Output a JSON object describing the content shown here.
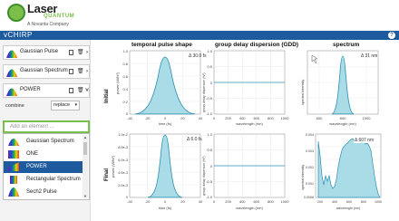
{
  "brand": {
    "name": "Laser",
    "sub": "QUANTUM",
    "tag": "A Novanta Company"
  },
  "app": {
    "title": "vCHIRP",
    "help": "?"
  },
  "pulses": [
    {
      "label": "Gaussian Pulse"
    },
    {
      "label": "Gaussian Spectrum"
    },
    {
      "label": "POWER"
    }
  ],
  "combine": {
    "label": "combine",
    "value": "replace"
  },
  "add_element": {
    "placeholder": "Add an element ..."
  },
  "dropdown": {
    "items": [
      "Gaussian Spectrum",
      "ONE",
      "POWER",
      "Rectangular Spectrum",
      "Sech2 Pulse"
    ],
    "selected": "POWER"
  },
  "plots": {
    "col_titles": [
      "temporal pulse shape",
      "group delay dispersion (GDD)",
      "spectrum"
    ],
    "rows": [
      "Initial",
      "Final"
    ],
    "initial": {
      "temporal": {
        "annotation": "Δ 30.0 fs",
        "ylabel": "power (W/fs²)",
        "xlabel": "time (fs)",
        "yticks": [
          "1.0",
          "0.8",
          "0.6",
          "0.4",
          "0.2",
          "0"
        ],
        "xticks": [
          "-40",
          "-20",
          "0",
          "20",
          "40"
        ]
      },
      "gdd": {
        "ylabel": "group delay dispersion (fs²)",
        "xlabel": "wavelength (nm)",
        "yticks": [
          "1.0",
          "0.5",
          "0",
          "-0.5",
          "-1.0"
        ],
        "xticks": [
          "0",
          "200",
          "400",
          "600",
          "800",
          "1000"
        ]
      },
      "spectrum": {
        "annotation": "Δ 31 nm",
        "ylabel": "spectral intensity",
        "xlabel": "wavelength (nm)",
        "xticks": [
          "600",
          "800",
          "1000"
        ]
      }
    },
    "final": {
      "temporal": {
        "annotation": "Δ 6.0 fs",
        "ylabel": "power (W/fs²)",
        "xlabel": "time (fs)",
        "yticks": [
          "1.0e-2",
          "8.0e-3",
          "6.0e-3",
          "4.0e-3",
          "2.0e-3",
          "0"
        ],
        "xticks": [
          "-40",
          "-20",
          "0",
          "20",
          "40"
        ]
      },
      "gdd": {
        "ylabel": "group delay dispersion (fs²)",
        "xlabel": "wavelength (nm)",
        "yticks": [
          "1.0",
          "0.5",
          "0",
          "-0.5",
          "-1.0"
        ],
        "xticks": [
          "0",
          "200",
          "400",
          "600",
          "800",
          "1000"
        ]
      },
      "spectrum": {
        "annotation": "Δ 607 nm",
        "ylabel": "spectral intensity",
        "xlabel": "wavelength (nm)",
        "yticks": [
          "0.004",
          "0.003",
          "0.002",
          "0.001",
          "0.0006"
        ],
        "xticks": [
          "200",
          "400",
          "600",
          "800",
          "1000"
        ]
      }
    }
  },
  "colors": {
    "accent": "#1d5a9e",
    "brand_green": "#7bbf4a",
    "plot_line": "#2b8fb0",
    "plot_fill": "#a9dce6"
  }
}
